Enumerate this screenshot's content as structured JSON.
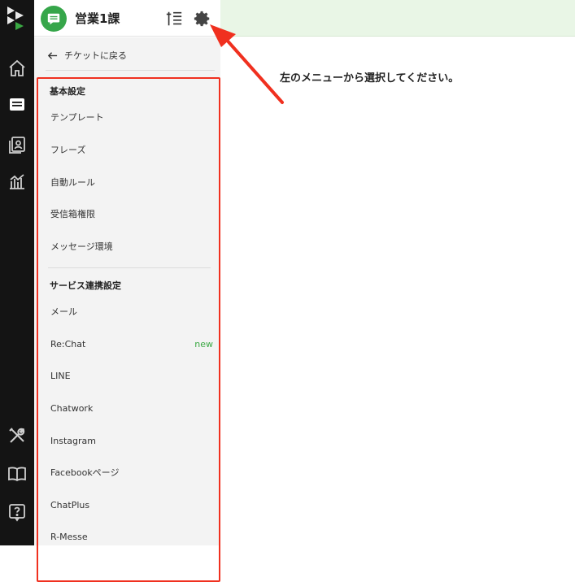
{
  "rail": {
    "logo": "app-logo",
    "items": [
      {
        "name": "home-icon"
      },
      {
        "name": "ticket-icon"
      },
      {
        "name": "contacts-icon"
      },
      {
        "name": "analytics-icon"
      },
      {
        "name": "tools-icon"
      },
      {
        "name": "guide-book-icon"
      },
      {
        "name": "help-icon"
      }
    ]
  },
  "header": {
    "inbox_name": "営業1課",
    "inbox_icon": "inbox-chat-icon",
    "filter_icon": "sort-list-icon",
    "settings_icon": "gear-icon"
  },
  "sidebar": {
    "back_label": "チケットに戻る",
    "section_basic": "基本設定",
    "basic_items": [
      "テンプレート",
      "フレーズ",
      "自動ルール",
      "受信箱権限",
      "メッセージ環境"
    ],
    "section_service": "サービス連携設定",
    "service_items": [
      "メール",
      "Re:Chat",
      "LINE",
      "Chatwork",
      "Instagram",
      "Facebookページ",
      "ChatPlus",
      "R-Messe"
    ],
    "new_badge": "new"
  },
  "main": {
    "message": "左のメニューから選択してください。"
  },
  "colors": {
    "rail_bg": "#141414",
    "header_green": "#e9f6e6",
    "brand_green": "#36a64a",
    "highlight_red": "#f0301f"
  }
}
